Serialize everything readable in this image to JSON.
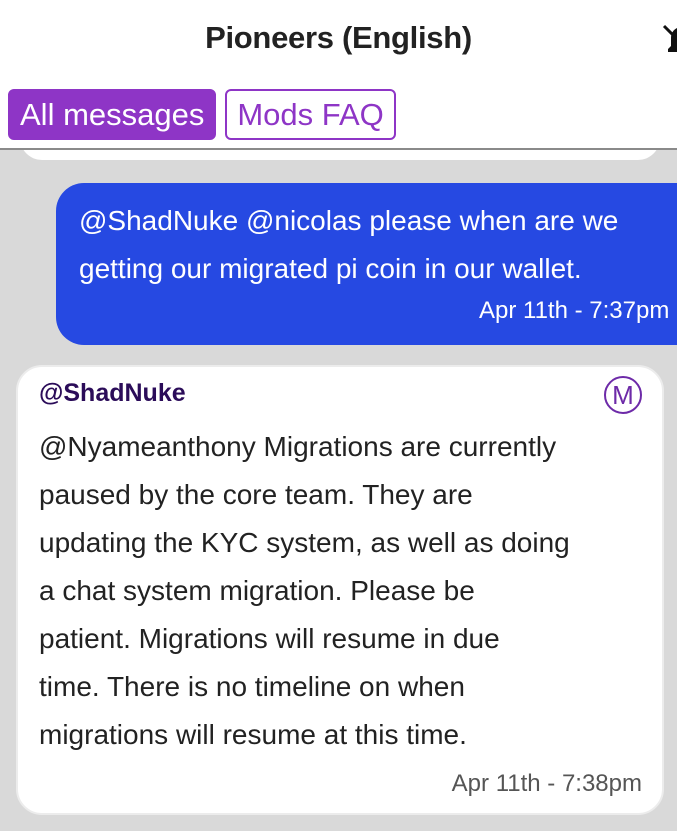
{
  "header": {
    "title": "Pioneers (English)",
    "mute_icon": "bell-slash-icon"
  },
  "tabs": [
    {
      "label": "All messages",
      "active": true
    },
    {
      "label": "Mods FAQ",
      "active": false
    }
  ],
  "colors": {
    "accent": "#8e35c6",
    "outgoing_bubble": "#2649e2",
    "chat_background": "#d9d9d9",
    "sender_name": "#2b0c59"
  },
  "messages": [
    {
      "direction": "outgoing",
      "text": "@ShadNuke @nicolas please when are we\ngetting our migrated pi coin in our wallet.",
      "time": "Apr 11th - 7:37pm"
    },
    {
      "direction": "incoming",
      "sender": "@ShadNuke",
      "badge": "M",
      "badge_icon": "moderator-badge-icon",
      "text": "@Nyameanthony Migrations are currently\npaused by the core team. They are\nupdating the KYC system, as well as doing\na chat system migration. Please be\npatient. Migrations will resume in due\ntime. There is no timeline on when\nmigrations will resume at this time.",
      "time": "Apr 11th - 7:38pm"
    }
  ]
}
